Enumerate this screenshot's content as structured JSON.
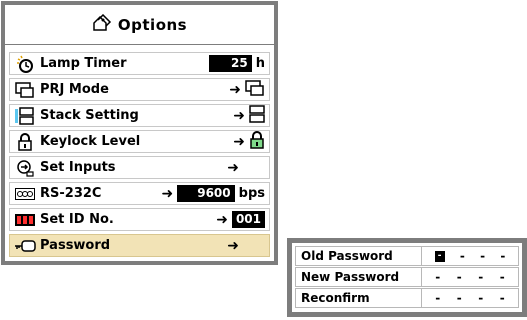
{
  "options": {
    "title": "Options",
    "items": [
      {
        "label": "Lamp Timer",
        "value": "25",
        "unit": "h",
        "icon": "lamp-timer-icon"
      },
      {
        "label": "PRJ Mode",
        "arrow": "➜",
        "icon": "prj-mode-icon"
      },
      {
        "label": "Stack Setting",
        "arrow": "➜",
        "icon": "stack-icon"
      },
      {
        "label": "Keylock Level",
        "arrow": "➜",
        "icon": "keylock-icon"
      },
      {
        "label": "Set Inputs",
        "arrow": "➜",
        "icon": "set-inputs-icon"
      },
      {
        "label": "RS-232C",
        "arrow": "➜",
        "value": "9600",
        "unit": "bps",
        "icon": "rs232c-icon"
      },
      {
        "label": "Set ID No.",
        "arrow": "➜",
        "value": "001",
        "icon": "set-id-icon"
      },
      {
        "label": "Password",
        "arrow": "➜",
        "icon": "password-key-icon",
        "selected": true
      }
    ]
  },
  "password_dialog": {
    "rows": [
      {
        "label": "Old Password",
        "digits": [
          "-",
          "-",
          "-",
          "-"
        ],
        "cursor_index": 0
      },
      {
        "label": "New Password",
        "digits": [
          "-",
          "-",
          "-",
          "-"
        ]
      },
      {
        "label": "Reconfirm",
        "digits": [
          "-",
          "-",
          "-",
          "-"
        ]
      }
    ]
  },
  "colors": {
    "frame": "#7d7d7d",
    "selected_row": "#f2e3b6",
    "value_box": "#000000",
    "icon_green": "#3a8a3a",
    "icon_yellow": "#f0d000"
  }
}
